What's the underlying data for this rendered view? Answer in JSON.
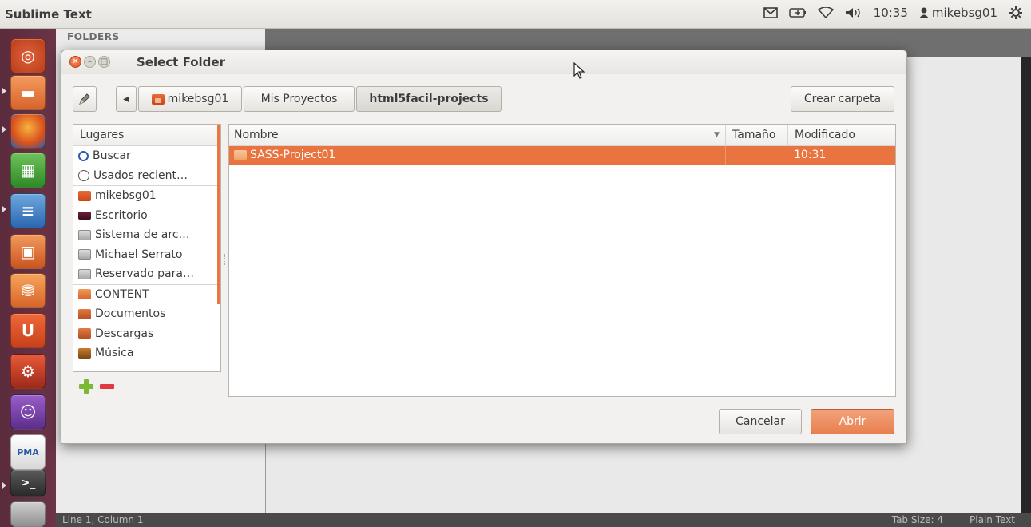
{
  "topbar": {
    "app_title": "Sublime Text",
    "time": "10:35",
    "username": "mikebsg01",
    "indicators": [
      "mail-icon",
      "battery-icon",
      "wifi-icon",
      "volume-icon",
      "power-gear-icon"
    ]
  },
  "launcher": {
    "items": [
      "dash-home",
      "files",
      "firefox",
      "libreoffice-calc",
      "libreoffice-writer",
      "libreoffice-impress",
      "ubuntu-software-center",
      "ubuntu-one",
      "system-settings",
      "pidgin",
      "phpmyadmin",
      "terminal",
      "workspaces"
    ]
  },
  "sublime": {
    "sidebar_label": "FOLDERS",
    "status": {
      "position": "Line 1, Column 1",
      "tab_size": "Tab Size: 4",
      "syntax": "Plain Text"
    }
  },
  "dialog": {
    "title": "Select Folder",
    "breadcrumbs": [
      "mikebsg01",
      "Mis Proyectos",
      "html5facil-projects"
    ],
    "create_folder_label": "Crear carpeta",
    "places_header": "Lugares",
    "places": [
      {
        "label": "Buscar",
        "icon": "search-icon"
      },
      {
        "label": "Usados recient…",
        "icon": "recent-icon"
      },
      {
        "label": "mikebsg01",
        "icon": "home-folder-icon"
      },
      {
        "label": "Escritorio",
        "icon": "desktop-icon"
      },
      {
        "label": "Sistema de arc…",
        "icon": "drive-icon"
      },
      {
        "label": "Michael Serrato",
        "icon": "drive-icon"
      },
      {
        "label": "Reservado para…",
        "icon": "drive-icon"
      },
      {
        "label": "CONTENT",
        "icon": "folder-icon"
      },
      {
        "label": "Documentos",
        "icon": "documents-icon"
      },
      {
        "label": "Descargas",
        "icon": "downloads-icon"
      },
      {
        "label": "Música",
        "icon": "music-icon"
      }
    ],
    "columns": {
      "name": "Nombre",
      "size": "Tamaño",
      "modified": "Modificado"
    },
    "files": [
      {
        "name": "SASS-Project01",
        "size": "",
        "modified": "10:31",
        "selected": true
      }
    ],
    "cancel_label": "Cancelar",
    "open_label": "Abrir"
  },
  "colors": {
    "accent": "#e9743f",
    "launcher_bg": "#5a2b3c",
    "panel_bg": "#f2f1f0"
  }
}
